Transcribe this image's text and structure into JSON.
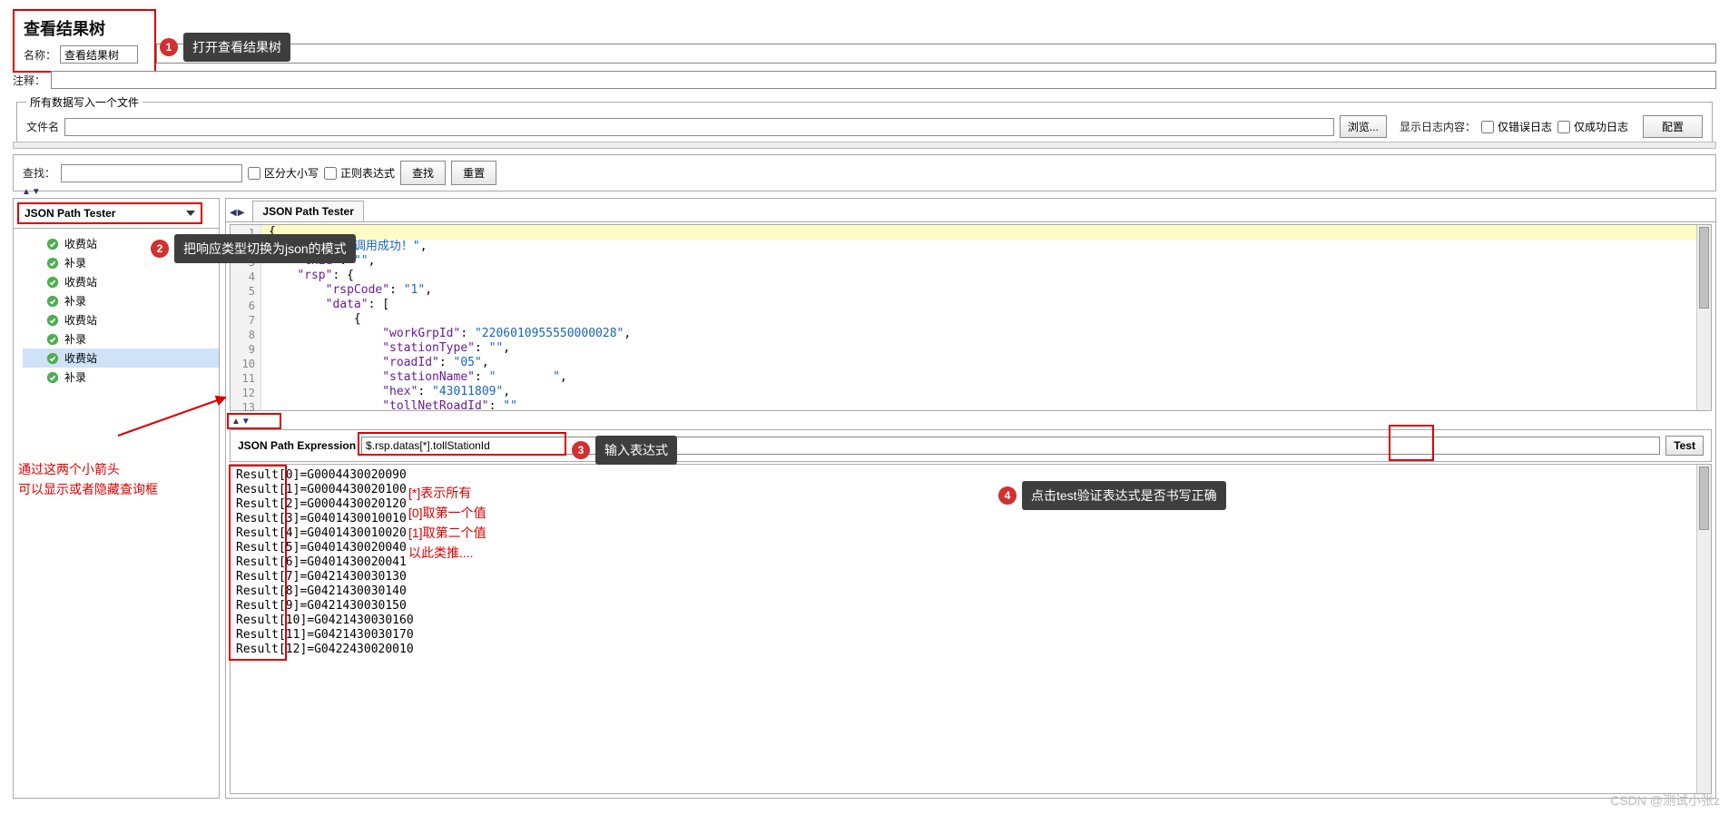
{
  "header": {
    "title": "查看结果树",
    "name_label": "名称：",
    "name_value": "查看结果树",
    "comment_label": "注释："
  },
  "fileset": {
    "legend": "所有数据写入一个文件",
    "filename_label": "文件名",
    "browse_btn": "浏览...",
    "show_log_label": "显示日志内容：",
    "only_error": "仅错误日志",
    "only_success": "仅成功日志",
    "config_btn": "配置"
  },
  "search": {
    "label": "查找：",
    "case": "区分大小写",
    "regex": "正则表达式",
    "find_btn": "查找",
    "reset_btn": "重置"
  },
  "tester": {
    "dropdown": "JSON Path Tester",
    "tab": "JSON Path Tester",
    "expr_label": "JSON Path Expression",
    "expr_value": "$.rsp.datas[*].tollStationId",
    "test_btn": "Test"
  },
  "tree_items": [
    "收费站",
    "补录",
    "收费站",
    "补录",
    "收费站",
    "补录",
    "收费站",
    "补录"
  ],
  "tree_selected_index": 6,
  "code_lines": [
    "{",
    "    \"msg\": \"调用成功！\",",
    "    \"txid\": \"\",",
    "    \"rsp\": {",
    "        \"rspCode\": \"1\",",
    "        \"data\": [",
    "            {",
    "                \"workGrpId\": \"2206010955550000028\",",
    "                \"stationType\": \"\",",
    "                \"roadId\": \"05\",",
    "                \"stationName\": \"        \",",
    "                \"hex\": \"43011809\",",
    "                \"tollNetRoadId\": \"\""
  ],
  "results": [
    "Result[0]=G0004430020090",
    "Result[1]=G0004430020100",
    "Result[2]=G0004430020120",
    "Result[3]=G0401430010010",
    "Result[4]=G0401430010020",
    "Result[5]=G0401430020040",
    "Result[6]=G0401430020041",
    "Result[7]=G0421430030130",
    "Result[8]=G0421430030140",
    "Result[9]=G0421430030150",
    "Result[10]=G0421430030160",
    "Result[11]=G0421430030170",
    "Result[12]=G0422430020010"
  ],
  "callouts": {
    "c1": "打开查看结果树",
    "c2": "把响应类型切换为json的模式",
    "c3": "输入表达式",
    "c4": "点击test验证表达式是否书写正确",
    "arrow_note1": "通过这两个小箭头",
    "arrow_note2": "可以显示或者隐藏查询框",
    "hint_lines": [
      "[*]表示所有",
      "[0]取第一个值",
      "[1]取第二个值",
      "以此类推...."
    ]
  },
  "watermark": "CSDN @测试小张z"
}
